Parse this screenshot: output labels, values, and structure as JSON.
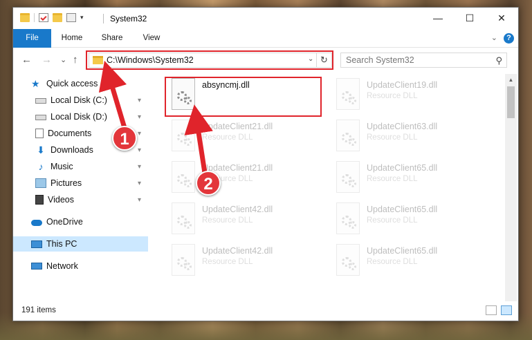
{
  "window": {
    "title": "System32",
    "controls": {
      "minimize": "—",
      "maximize": "☐",
      "close": "✕"
    }
  },
  "ribbon": {
    "tabs": [
      "File",
      "Home",
      "Share",
      "View"
    ],
    "help": "?",
    "collapse": "⌄"
  },
  "navigation": {
    "back": "←",
    "forward": "→",
    "recent": "⌄",
    "up": "↑",
    "address": "C:\\Windows\\System32",
    "address_dropdown": "⌄",
    "refresh": "↻",
    "search_placeholder": "Search System32",
    "search_icon": "⚲"
  },
  "sidebar": {
    "items": [
      {
        "label": "Quick access",
        "icon": "star-icon",
        "pinned": false
      },
      {
        "label": "Local Disk (C:)",
        "icon": "drive-icon",
        "pinned": true
      },
      {
        "label": "Local Disk (D:)",
        "icon": "drive-icon",
        "pinned": true
      },
      {
        "label": "Documents",
        "icon": "documents-icon",
        "pinned": true
      },
      {
        "label": "Downloads",
        "icon": "downloads-icon",
        "pinned": true
      },
      {
        "label": "Music",
        "icon": "music-icon",
        "pinned": true
      },
      {
        "label": "Pictures",
        "icon": "pictures-icon",
        "pinned": true
      },
      {
        "label": "Videos",
        "icon": "videos-icon",
        "pinned": true
      },
      {
        "label": "OneDrive",
        "icon": "onedrive-icon",
        "pinned": false
      },
      {
        "label": "This PC",
        "icon": "this-pc-icon",
        "pinned": false,
        "selected": true
      },
      {
        "label": "Network",
        "icon": "network-icon",
        "pinned": false
      }
    ],
    "pin_glyph": "📌"
  },
  "files": [
    {
      "name": "absyncmj.dll",
      "type": "",
      "highlighted": true
    },
    {
      "name": "UpdateClient19.dll",
      "type": "Resource DLL"
    },
    {
      "name": "UpdateClient21.dll",
      "type": "Resource DLL"
    },
    {
      "name": "UpdateClient63.dll",
      "type": "Resource DLL"
    },
    {
      "name": "UpdateClient21.dll",
      "type": "Resource DLL"
    },
    {
      "name": "UpdateClient65.dll",
      "type": "Resource DLL"
    },
    {
      "name": "UpdateClient42.dll",
      "type": "Resource DLL"
    },
    {
      "name": "UpdateClient65.dll",
      "type": "Resource DLL"
    },
    {
      "name": "UpdateClient42.dll",
      "type": "Resource DLL"
    },
    {
      "name": "UpdateClient65.dll",
      "type": "Resource DLL"
    }
  ],
  "status": {
    "item_count": "191 items"
  },
  "annotations": {
    "step1": "1",
    "step2": "2",
    "color": "#e0242b"
  },
  "colors": {
    "accent": "#1979ca",
    "selection": "#cce8ff",
    "highlight": "#e0242b"
  }
}
